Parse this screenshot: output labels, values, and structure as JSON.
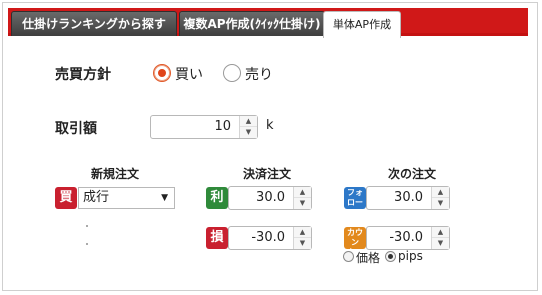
{
  "tabs": [
    {
      "label": "仕掛けランキングから探す"
    },
    {
      "label": "複数AP作成(ｸｲｯｸ仕掛け)"
    },
    {
      "label": "単体AP作成"
    }
  ],
  "side": {
    "label": "売買方針",
    "options": [
      {
        "label": "買い",
        "checked": true
      },
      {
        "label": "売り",
        "checked": false
      }
    ]
  },
  "amount": {
    "label": "取引額",
    "value": "10",
    "unit": "k"
  },
  "columns": {
    "new_order": "新規注文",
    "settle_order": "決済注文",
    "next_order": "次の注文"
  },
  "new_order": {
    "badge": "買",
    "type": "成行"
  },
  "settle": {
    "profit_badge": "利",
    "profit_value": "30.0",
    "loss_badge": "損",
    "loss_value": "-30.0"
  },
  "next": {
    "follow_badge": "フォロー",
    "follow_value": "30.0",
    "counter_badge": "カウンター",
    "counter_value": "-30.0",
    "unit_options": [
      {
        "label": "価格",
        "checked": false
      },
      {
        "label": "pips",
        "checked": true
      }
    ]
  },
  "colors": {
    "tabbar": "#d01818",
    "accent": "#e0451b"
  }
}
